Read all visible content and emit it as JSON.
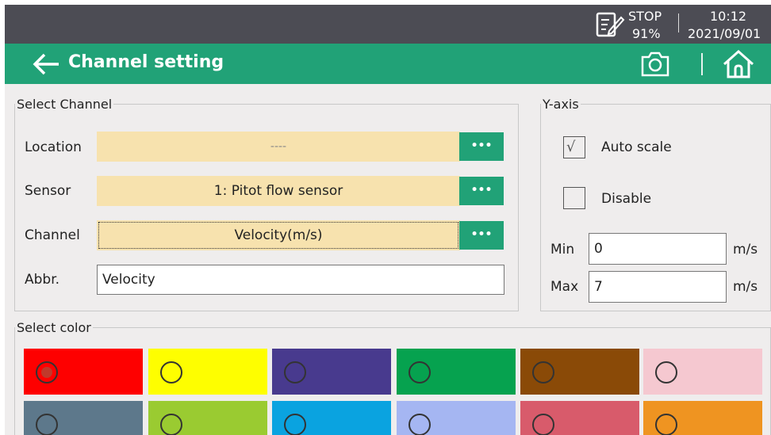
{
  "status": {
    "recording": "STOP",
    "battery": "91%",
    "time": "10:12",
    "date": "2021/09/01"
  },
  "header": {
    "title": "Channel setting"
  },
  "channel": {
    "legend": "Select Channel",
    "location": {
      "label": "Location",
      "value": "----"
    },
    "sensor": {
      "label": "Sensor",
      "value": "1: Pitot flow sensor"
    },
    "channel": {
      "label": "Channel",
      "value": "Velocity(m/s)"
    },
    "abbr": {
      "label": "Abbr.",
      "value": "Velocity"
    },
    "more_label": "•••"
  },
  "yaxis": {
    "legend": "Y-axis",
    "auto_scale": {
      "label": "Auto scale",
      "checked": true,
      "mark": "√"
    },
    "disable": {
      "label": "Disable",
      "checked": false
    },
    "min": {
      "label": "Min",
      "value": "0",
      "unit": "m/s"
    },
    "max": {
      "label": "Max",
      "value": "7",
      "unit": "m/s"
    }
  },
  "color": {
    "legend": "Select color",
    "selected_index": 0,
    "swatches": [
      "#fe0000",
      "#fefe00",
      "#483a8e",
      "#06a24f",
      "#8a4a07",
      "#f5c8d0",
      "#5d788b",
      "#9acb31",
      "#0aa3e0",
      "#a5b6f2",
      "#d85b6b",
      "#ef9421"
    ]
  }
}
